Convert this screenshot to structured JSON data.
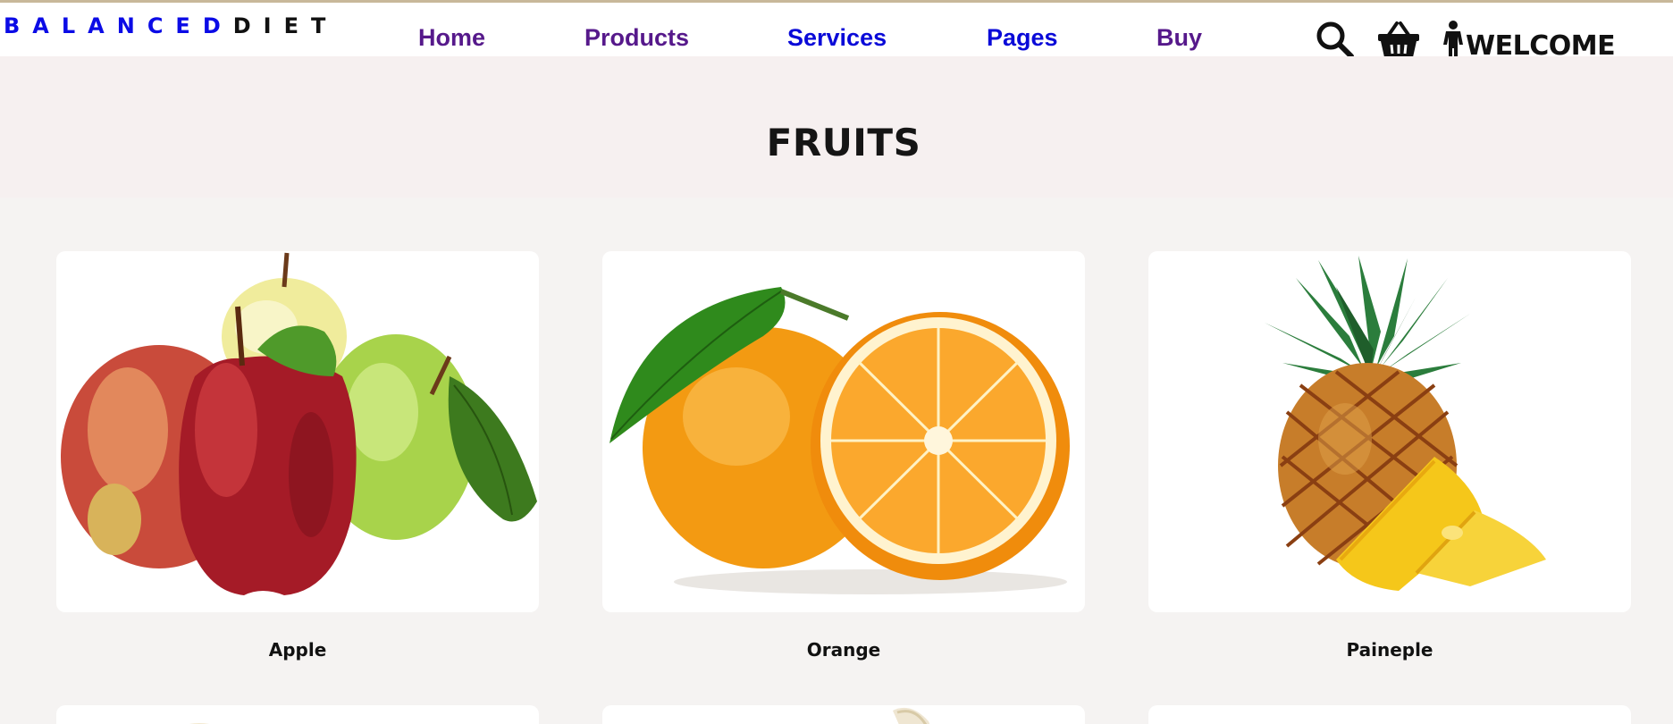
{
  "header": {
    "logo_part1": "BALANCED",
    "logo_part2": "DIET",
    "welcome": "WELCOME",
    "icons": [
      "search-icon",
      "basket-icon",
      "person-icon"
    ]
  },
  "nav": {
    "items": [
      {
        "label": "Home"
      },
      {
        "label": "Products"
      },
      {
        "label": "Services"
      },
      {
        "label": "Pages"
      },
      {
        "label": "Buy"
      }
    ]
  },
  "banner": {
    "title": "FRUITS"
  },
  "products": [
    {
      "name": "Apple",
      "image": "apple-image"
    },
    {
      "name": "Orange",
      "image": "orange-image"
    },
    {
      "name": "Paineple",
      "image": "pineapple-image"
    }
  ],
  "colors": {
    "logo_blue": "#0b0be6",
    "nav_visited": "#56198b",
    "nav_link": "#0a0ad8",
    "banner_bg": "#f6f0f0",
    "page_bg": "#f5f3f2"
  }
}
